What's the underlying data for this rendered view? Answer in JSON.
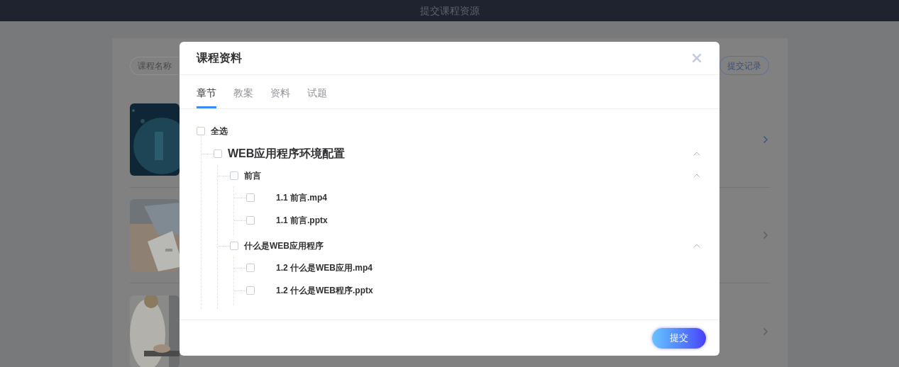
{
  "header": {
    "title": "提交课程资源"
  },
  "background": {
    "search": {
      "placeholder": "课程名称"
    },
    "record_button": "提交记录"
  },
  "dialog": {
    "title": "课程资料",
    "tabs": [
      {
        "label": "章节",
        "selected": true
      },
      {
        "label": "教案",
        "selected": false
      },
      {
        "label": "资料",
        "selected": false
      },
      {
        "label": "试题",
        "selected": false
      }
    ],
    "select_all": {
      "label": "全选",
      "checked": false
    },
    "tree": [
      {
        "label": "WEB应用程序环境配置",
        "checked": false,
        "expanded": true,
        "children": [
          {
            "label": "前言",
            "checked": false,
            "expanded": true,
            "children": [
              {
                "label": "1.1 前言.mp4",
                "checked": false
              },
              {
                "label": "1.1 前言.pptx",
                "checked": false
              }
            ]
          },
          {
            "label": "什么是WEB应用程序",
            "checked": false,
            "expanded": true,
            "children": [
              {
                "label": "1.2 什么是WEB应用.mp4",
                "checked": false
              },
              {
                "label": "1.2 什么是WEB程序.pptx",
                "checked": false
              }
            ]
          }
        ]
      }
    ],
    "submit_button": "提交"
  }
}
